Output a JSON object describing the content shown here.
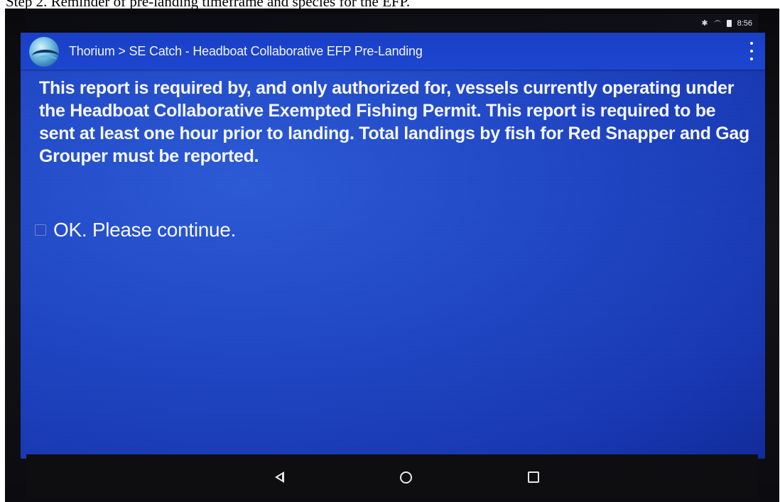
{
  "caption": "Step 2. Reminder of pre-landing timeframe and species for the EFP.",
  "status_bar": {
    "time": "8:56",
    "icons": [
      "bluetooth-icon",
      "wifi-icon",
      "battery-icon"
    ]
  },
  "app_bar": {
    "title": "Thorium > SE Catch - Headboat Collaborative EFP Pre-Landing",
    "logo": "thorium-logo-icon",
    "menu_icon": "overflow-menu-icon"
  },
  "message": "This report is required by, and only authorized for, vessels currently operating under the Headboat Collaborative Exempted Fishing Permit. This report is required to be sent at least one hour prior to landing. Total landings by fish for Red Snapper and Gag Grouper must be reported.",
  "confirm": {
    "label": "OK. Please continue.",
    "checked": false
  },
  "nav_bar": {
    "buttons": [
      "back-icon",
      "home-icon",
      "recents-icon"
    ]
  },
  "colors": {
    "screen_blue": "#1f45c4",
    "app_bar_blue": "#1a3fc6",
    "text": "#f5f7ff",
    "bezel": "#0e0e11"
  }
}
